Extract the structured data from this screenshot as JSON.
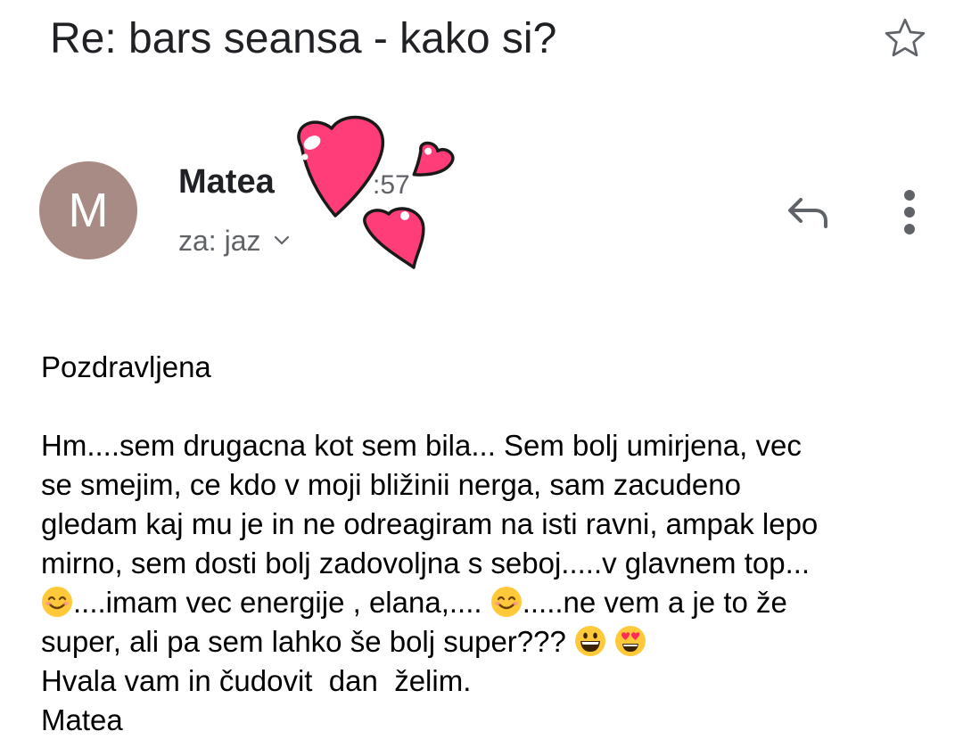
{
  "email": {
    "subject": "Re: bars seansa - kako si?",
    "sender": {
      "name": "Matea",
      "avatar_letter": "M",
      "avatar_color": "#a88b84"
    },
    "time_partial": ":57",
    "recipients_label": "za: jaz",
    "body": {
      "greeting": "Pozdravljena",
      "line1": "Hm....sem drugacna kot sem bila... Sem bolj umirjena, vec",
      "line2": "se smejim, ce kdo v moji bližinii nerga, sam zacudeno",
      "line3": "gledam kaj mu je in ne odreagiram na isti ravni, ampak lepo",
      "line4": "mirno, sem dosti bolj zadovoljna s seboj.....v glavnem top...",
      "line5a": "....imam vec energije , elana,.... ",
      "line5b": ".....ne vem a je to že",
      "line6": "super, ali pa sem lahko še bolj super??? ",
      "line7": "Hvala vam in čudovit  dan  želim.",
      "signature": "Matea"
    }
  },
  "icons": {
    "star": "star-outline-icon",
    "reply": "reply-arrow-icon",
    "more": "more-vertical-icon",
    "expand": "chevron-down-icon",
    "sticker": "hearts-sticker",
    "emoji_smile": "smiling-face-emoji",
    "emoji_grin": "grinning-face-emoji",
    "emoji_heart_eyes": "heart-eyes-emoji"
  },
  "colors": {
    "heart_pink": "#ff3d79",
    "heart_outline": "#1a1a1a",
    "icon_gray": "#5f6368",
    "emoji_yellow": "#ffc93a"
  }
}
